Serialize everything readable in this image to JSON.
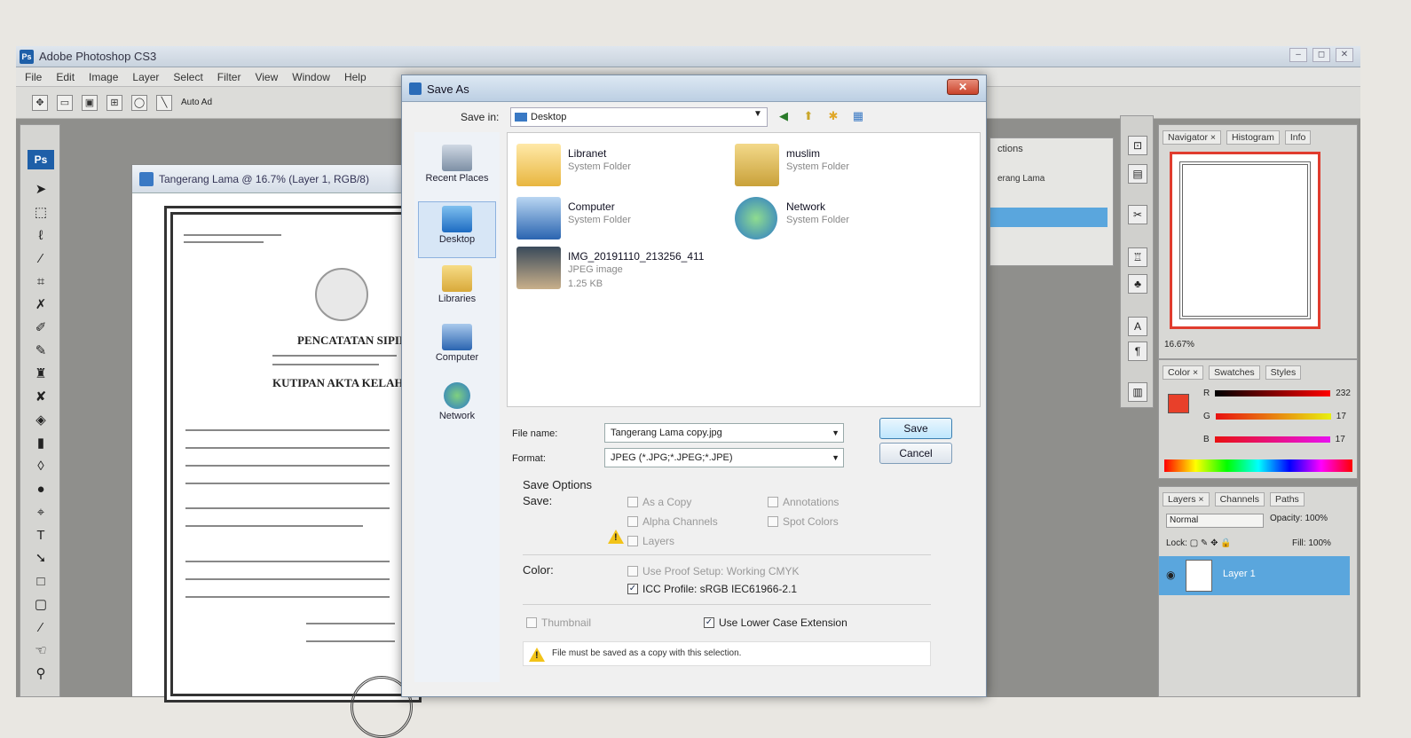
{
  "app": {
    "title": "Adobe Photoshop CS3",
    "logo": "Ps",
    "menu": [
      "File",
      "Edit",
      "Image",
      "Layer",
      "Select",
      "Filter",
      "View",
      "Window",
      "Help"
    ],
    "window_controls": [
      "–",
      "◻",
      "✕"
    ],
    "options_bar_auto": "Auto Ad"
  },
  "document": {
    "title": "Tangerang Lama @ 16.7% (Layer 1, RGB/8)",
    "certificate_heading": "PENCATATAN SIPIL",
    "certificate_sub": "KUTIPAN AKTA KELAHI"
  },
  "actions_panel": {
    "tab": "ctions",
    "item": "erang Lama"
  },
  "navigator_panel": {
    "tabs": [
      "Navigator ×",
      "Histogram",
      "Info"
    ],
    "zoom": "16.67%"
  },
  "color_panel": {
    "tabs": [
      "Color ×",
      "Swatches",
      "Styles"
    ],
    "r_label": "R",
    "g_label": "G",
    "b_label": "B",
    "r_value": "232",
    "g_value": "17",
    "b_value": "17",
    "fg_color": "#e8402a"
  },
  "layers_panel": {
    "tabs": [
      "Layers ×",
      "Channels",
      "Paths"
    ],
    "blend_mode": "Normal",
    "opacity_label": "Opacity:",
    "opacity": "100%",
    "lock_label": "Lock:",
    "fill_label": "Fill:",
    "fill": "100%",
    "layer_name": "Layer 1"
  },
  "dialog": {
    "title": "Save As",
    "close": "✕",
    "save_in_label": "Save in:",
    "save_in_value": "Desktop",
    "places": [
      "Recent Places",
      "Desktop",
      "Libraries",
      "Computer",
      "Network"
    ],
    "files": [
      {
        "name": "Libranet",
        "type": "System Folder",
        "size": ""
      },
      {
        "name": "muslim",
        "type": "System Folder",
        "size": ""
      },
      {
        "name": "Computer",
        "type": "System Folder",
        "size": ""
      },
      {
        "name": "Network",
        "type": "System Folder",
        "size": ""
      },
      {
        "name": "IMG_20191110_213256_411",
        "type": "JPEG image",
        "size": "1.25 KB"
      }
    ],
    "file_name_label": "File name:",
    "file_name": "Tangerang Lama copy.jpg",
    "format_label": "Format:",
    "format": "JPEG (*.JPG;*.JPEG;*.JPE)",
    "save_button": "Save",
    "cancel_button": "Cancel",
    "save_options_title": "Save Options",
    "save_label": "Save:",
    "opt_as_copy": "As a Copy",
    "opt_annotations": "Annotations",
    "opt_alpha": "Alpha Channels",
    "opt_spot": "Spot Colors",
    "opt_layers": "Layers",
    "color_label": "Color:",
    "opt_proof": "Use Proof Setup:  Working CMYK",
    "opt_icc": "ICC Profile:  sRGB IEC61966-2.1",
    "opt_thumbnail": "Thumbnail",
    "opt_lowercase": "Use Lower Case Extension",
    "footnote": "File must be saved as a copy with this selection."
  }
}
